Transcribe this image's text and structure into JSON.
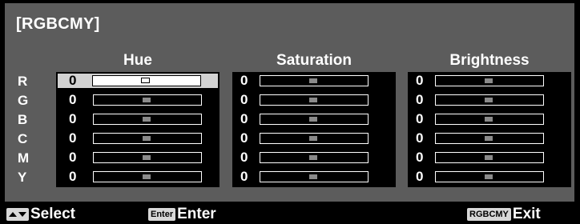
{
  "title": "[RGBCMY]",
  "columns": [
    "Hue",
    "Saturation",
    "Brightness"
  ],
  "rows": [
    {
      "label": "R",
      "values": [
        "0",
        "0",
        "0"
      ]
    },
    {
      "label": "G",
      "values": [
        "0",
        "0",
        "0"
      ]
    },
    {
      "label": "B",
      "values": [
        "0",
        "0",
        "0"
      ]
    },
    {
      "label": "C",
      "values": [
        "0",
        "0",
        "0"
      ]
    },
    {
      "label": "M",
      "values": [
        "0",
        "0",
        "0"
      ]
    },
    {
      "label": "Y",
      "values": [
        "0",
        "0",
        "0"
      ]
    }
  ],
  "selected_cell": {
    "row": "R",
    "column": "Hue"
  },
  "slider_level": 0.5,
  "footer": {
    "select": {
      "text": "Select",
      "icon": "up-down-arrows-icon"
    },
    "enter": {
      "key": "Enter",
      "text": "Enter"
    },
    "exit": {
      "key": "RGBCMY",
      "text": "Exit"
    }
  },
  "colors": {
    "panel_bg": "#5c5c5c",
    "cell_bg": "#000000",
    "selected_bg": "#d2d2d2",
    "text": "#ffffff"
  }
}
